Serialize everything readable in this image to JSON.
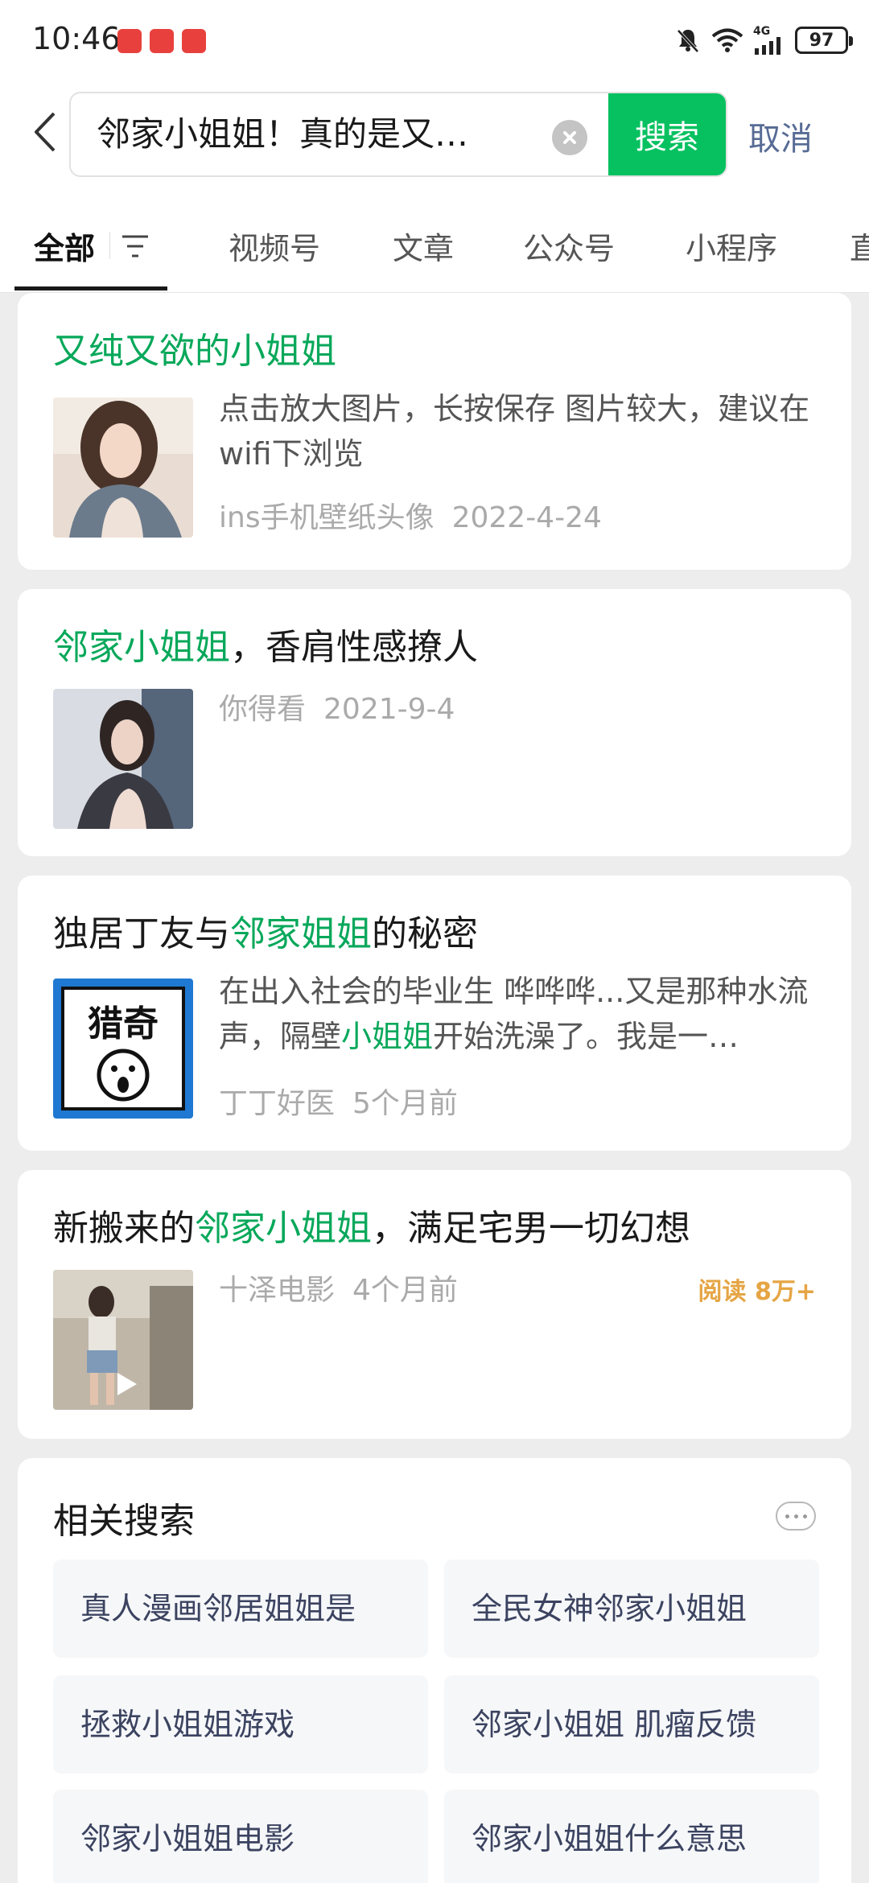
{
  "status_bar": {
    "time": "10:46",
    "network": "4G",
    "battery": "97",
    "notification_icons": [
      "app-notification-icon",
      "app-notification-icon",
      "app-notification-icon"
    ],
    "right_icons": [
      "mute-bell-icon",
      "wifi-icon",
      "signal-icon",
      "battery-icon"
    ]
  },
  "search": {
    "query": "邻家小姐姐！真的是又…",
    "button_label": "搜索",
    "cancel_label": "取消"
  },
  "tabs": [
    {
      "label": "全部",
      "active": true
    },
    {
      "label": "视频号"
    },
    {
      "label": "文章"
    },
    {
      "label": "公众号"
    },
    {
      "label": "小程序"
    },
    {
      "label": "直"
    }
  ],
  "results": [
    {
      "title_parts": [
        {
          "text": "又纯又欲的小姐姐",
          "hl": true
        }
      ],
      "description_parts": [
        {
          "text": "点击放大图片，长按保存 图片较大，建议在wifi下浏览"
        }
      ],
      "source": "ins手机壁纸头像",
      "date": "2022-4-24"
    },
    {
      "title_parts": [
        {
          "text": "邻家小姐姐",
          "hl": true
        },
        {
          "text": "，香肩性感撩人"
        }
      ],
      "source": "你得看",
      "date": "2021-9-4"
    },
    {
      "title_parts": [
        {
          "text": "独居丁友与"
        },
        {
          "text": "邻家姐姐",
          "hl": true
        },
        {
          "text": "的秘密"
        }
      ],
      "description_parts": [
        {
          "text": "在出入社会的毕业生 哗哗哗...又是那种水流声，隔壁"
        },
        {
          "text": "小姐姐",
          "hl": true
        },
        {
          "text": "开始洗澡了。我是一…"
        }
      ],
      "thumb_text": "猎奇",
      "source": "丁丁好医",
      "date": "5个月前"
    },
    {
      "title_parts": [
        {
          "text": "新搬来的"
        },
        {
          "text": "邻家小姐姐",
          "hl": true
        },
        {
          "text": "，满足宅男一切幻想"
        }
      ],
      "source": "十泽电影",
      "date": "4个月前",
      "reads": "阅读 8万+"
    }
  ],
  "related": {
    "title": "相关搜索",
    "items": [
      "真人漫画邻居姐姐是",
      "全民女神邻家小姐姐",
      "拯救小姐姐游戏",
      "邻家小姐姐 肌瘤反馈",
      "邻家小姐姐电影",
      "邻家小姐姐什么意思"
    ]
  },
  "colors": {
    "accent_green": "#07c160",
    "highlight_green": "#07a85a",
    "link_blue": "#576b95",
    "reads_orange": "#e5a544"
  }
}
